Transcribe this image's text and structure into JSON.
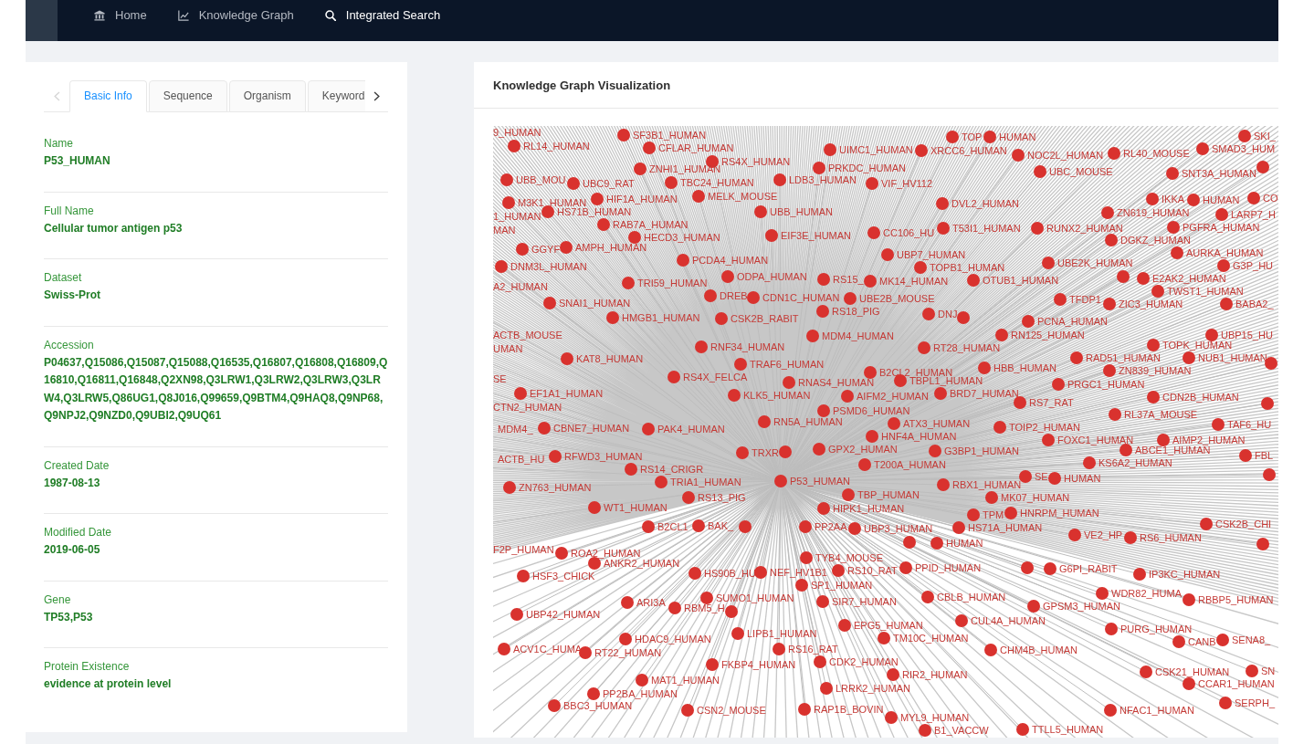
{
  "navbar": {
    "items": [
      {
        "label": "Home",
        "selected": false
      },
      {
        "label": "Knowledge Graph",
        "selected": false
      },
      {
        "label": "Integrated Search",
        "selected": true
      }
    ]
  },
  "detail_panel": {
    "scroll_buttons": [
      {
        "kind": "previous",
        "disabled": true
      },
      {
        "kind": "next",
        "disabled": false
      }
    ],
    "tabs": [
      {
        "label": "Basic Info",
        "selected": true
      },
      {
        "label": "Sequence",
        "selected": false
      },
      {
        "label": "Organism",
        "selected": false
      },
      {
        "label": "Keyword",
        "selected": false
      }
    ],
    "fields": [
      {
        "label": "Name",
        "value": "P53_HUMAN"
      },
      {
        "label": "Full Name",
        "value": "Cellular tumor antigen p53"
      },
      {
        "label": "Dataset",
        "value": "Swiss-Prot"
      },
      {
        "label": "Accession",
        "value": "P04637,Q15086,Q15087,Q15088,Q16535,Q16807,Q16808,Q16809,Q16810,Q16811,Q16848,Q2XN98,Q3LRW1,Q3LRW2,Q3LRW3,Q3LRW4,Q3LRW5,Q86UG1,Q8J016,Q99659,Q9BTM4,Q9HAQ8,Q9NP68,Q9NPJ2,Q9NZD0,Q9UBI2,Q9UQ61"
      },
      {
        "label": "Created Date",
        "value": "1987-08-13"
      },
      {
        "label": "Modified Date",
        "value": "2019-06-05"
      },
      {
        "label": "Gene",
        "value": "TP53,P53"
      },
      {
        "label": "Protein Existence",
        "value": "evidence at protein level"
      }
    ]
  },
  "graph_panel": {
    "title": "Knowledge Graph Visualization",
    "nodes": [
      {
        "kind": "labeled",
        "label": "9_HUMAN"
      },
      {
        "kind": "labeled",
        "label": "SF3B1_HUMAN"
      },
      {
        "kind": "labeled",
        "label": "TOP"
      },
      {
        "kind": "labeled",
        "label": "HUMAN"
      },
      {
        "kind": "labeled",
        "label": "SKI_"
      },
      {
        "kind": "labeled",
        "label": "RL14_HUMAN"
      },
      {
        "kind": "labeled",
        "label": "CFLAR_HUMAN"
      },
      {
        "kind": "labeled",
        "label": "UIMC1_HUMAN"
      },
      {
        "kind": "labeled",
        "label": "XRCC6_HUMAN"
      },
      {
        "kind": "labeled",
        "label": "NOC2L_HUMAN"
      },
      {
        "kind": "labeled",
        "label": "RL40_MOUSE"
      },
      {
        "kind": "labeled",
        "label": "SMAD3_HUM"
      },
      {
        "kind": "labeled",
        "label": "RS4X_HUMAN"
      },
      {
        "kind": "labeled",
        "label": "ZNHI1_HUMAN"
      },
      {
        "kind": "labeled",
        "label": "PRKDC_HUMAN"
      },
      {
        "kind": "labeled",
        "label": "UBC_MOUSE"
      },
      {
        "kind": "labeled",
        "label": "SNT3A_HUMAN"
      },
      {
        "kind": "unlabeled"
      },
      {
        "kind": "labeled",
        "label": "UBB_MOU"
      },
      {
        "kind": "labeled",
        "label": "UBC9_RAT"
      },
      {
        "kind": "labeled",
        "label": "TBC24_HUMAN"
      },
      {
        "kind": "labeled",
        "label": "LDB3_HUMAN"
      },
      {
        "kind": "labeled",
        "label": "VIF_HV112"
      },
      {
        "kind": "labeled",
        "label": "M3K1_HUMAN"
      },
      {
        "kind": "labeled",
        "label": "HIF1A_HUMAN"
      },
      {
        "kind": "labeled",
        "label": "MELK_MOUSE"
      },
      {
        "kind": "labeled",
        "label": "DVL2_HUMAN"
      },
      {
        "kind": "labeled",
        "label": "IKKA"
      },
      {
        "kind": "labeled",
        "label": "HUMAN"
      },
      {
        "kind": "labeled",
        "label": "CO"
      },
      {
        "kind": "labeled",
        "label": "1_HUMAN"
      },
      {
        "kind": "labeled",
        "label": "HS71B_HUMAN"
      },
      {
        "kind": "labeled",
        "label": "UBB_HUMAN"
      },
      {
        "kind": "labeled",
        "label": "ZN619_HUMAN"
      },
      {
        "kind": "labeled",
        "label": "LARP7_H"
      },
      {
        "kind": "labeled",
        "label": "MAN"
      },
      {
        "kind": "labeled",
        "label": "RAB7A_HUMAN"
      },
      {
        "kind": "labeled",
        "label": "HECD3_HUMAN"
      },
      {
        "kind": "labeled",
        "label": "EIF3E_HUMAN"
      },
      {
        "kind": "labeled",
        "label": "CC106_HU"
      },
      {
        "kind": "labeled",
        "label": "T53I1_HUMAN"
      },
      {
        "kind": "labeled",
        "label": "RUNX2_HUMAN"
      },
      {
        "kind": "labeled",
        "label": "PGFRA_HUMAN"
      },
      {
        "kind": "labeled",
        "label": "GGYF"
      },
      {
        "kind": "labeled",
        "label": "AMPH_HUMAN"
      },
      {
        "kind": "labeled",
        "label": "DGKZ_HUMAN"
      },
      {
        "kind": "labeled",
        "label": "PCDA4_HUMAN"
      },
      {
        "kind": "labeled",
        "label": "UBP7_HUMAN"
      },
      {
        "kind": "labeled",
        "label": "DNM3L_HUMAN"
      },
      {
        "kind": "labeled",
        "label": "TOPB1_HUMAN"
      },
      {
        "kind": "labeled",
        "label": "UBE2K_HUMAN"
      },
      {
        "kind": "labeled",
        "label": "AURKA_HUMAN"
      },
      {
        "kind": "labeled",
        "label": "G3P_HU"
      },
      {
        "kind": "labeled",
        "label": "ODPA_HUMAN"
      },
      {
        "kind": "labeled",
        "label": "A2_HUMAN"
      },
      {
        "kind": "labeled",
        "label": "TRI59_HUMAN"
      },
      {
        "kind": "labeled",
        "label": "RS15_"
      },
      {
        "kind": "labeled",
        "label": "MK14_HUMAN"
      },
      {
        "kind": "labeled",
        "label": "OTUB1_HUMAN"
      },
      {
        "kind": "unlabeled"
      },
      {
        "kind": "labeled",
        "label": "E2AK2_HUMAN"
      },
      {
        "kind": "labeled",
        "label": "DREB"
      },
      {
        "kind": "labeled",
        "label": "SNAI1_HUMAN"
      },
      {
        "kind": "labeled",
        "label": "CDN1C_HUMAN"
      },
      {
        "kind": "labeled",
        "label": "UBE2B_MOUSE"
      },
      {
        "kind": "labeled",
        "label": "TFDP1"
      },
      {
        "kind": "labeled",
        "label": "TWST1_HUMAN"
      },
      {
        "kind": "labeled",
        "label": "RS18_PIG"
      },
      {
        "kind": "labeled",
        "label": "HMGB1_HUMAN"
      },
      {
        "kind": "labeled",
        "label": "CSK2B_RABIT"
      },
      {
        "kind": "labeled",
        "label": "DNJ"
      },
      {
        "kind": "labeled",
        "label": "ZIC3_HUMAN"
      },
      {
        "kind": "labeled",
        "label": "BABA2_"
      },
      {
        "kind": "unlabeled"
      },
      {
        "kind": "labeled",
        "label": "PCNA_HUMAN"
      },
      {
        "kind": "labeled",
        "label": "ACTB_MOUSE"
      },
      {
        "kind": "labeled",
        "label": "MDM4_HUMAN"
      },
      {
        "kind": "labeled",
        "label": "RN125_HUMAN"
      },
      {
        "kind": "labeled",
        "label": "UBP15_HU"
      },
      {
        "kind": "labeled",
        "label": "UMAN"
      },
      {
        "kind": "labeled",
        "label": "RNF34_HUMAN"
      },
      {
        "kind": "labeled",
        "label": "RT28_HUMAN"
      },
      {
        "kind": "labeled",
        "label": "TOPK_HUMAN"
      },
      {
        "kind": "labeled",
        "label": "KAT8_HUMAN"
      },
      {
        "kind": "labeled",
        "label": "RAD51_HUMAN"
      },
      {
        "kind": "labeled",
        "label": "NUB1_HUMAN"
      },
      {
        "kind": "labeled",
        "label": "TRAF6_HUMAN"
      },
      {
        "kind": "labeled",
        "label": "SE"
      },
      {
        "kind": "labeled",
        "label": "RS4X_FELCA"
      },
      {
        "kind": "labeled",
        "label": "B2CL2_HUMAN"
      },
      {
        "kind": "labeled",
        "label": "HBB_HUMAN"
      },
      {
        "kind": "labeled",
        "label": "ZN839_HUMAN"
      },
      {
        "kind": "unlabeled"
      },
      {
        "kind": "labeled",
        "label": "RNAS4_HUMAN"
      },
      {
        "kind": "labeled",
        "label": "TBPL1_HUMAN"
      },
      {
        "kind": "labeled",
        "label": "PRGC1_HUMAN"
      },
      {
        "kind": "labeled",
        "label": "EF1A1_HUMAN"
      },
      {
        "kind": "labeled",
        "label": "KLK5_HUMAN"
      },
      {
        "kind": "labeled",
        "label": "AIFM2_HUMAN"
      },
      {
        "kind": "labeled",
        "label": "BRD7_HUMAN"
      },
      {
        "kind": "labeled",
        "label": "CTN2_HUMAN"
      },
      {
        "kind": "labeled",
        "label": "RS7_RAT"
      },
      {
        "kind": "labeled",
        "label": "CDN2B_HUMAN"
      },
      {
        "kind": "unlabeled"
      },
      {
        "kind": "labeled",
        "label": "PSMD6_HUMAN"
      },
      {
        "kind": "labeled",
        "label": "RL37A_MOUSE"
      },
      {
        "kind": "labeled",
        "label": "RN5A_HUMAN"
      },
      {
        "kind": "labeled",
        "label": "MDM4_"
      },
      {
        "kind": "labeled",
        "label": "CBNE7_HUMAN"
      },
      {
        "kind": "labeled",
        "label": "PAK4_HUMAN"
      },
      {
        "kind": "labeled",
        "label": "ATX3_HUMAN"
      },
      {
        "kind": "labeled",
        "label": "TOIP2_HUMAN"
      },
      {
        "kind": "labeled",
        "label": "TAF6_HU"
      },
      {
        "kind": "labeled",
        "label": "HNF4A_HUMAN"
      },
      {
        "kind": "labeled",
        "label": "FOXC1_HUMAN"
      },
      {
        "kind": "labeled",
        "label": "AIMP2_HUMAN"
      },
      {
        "kind": "labeled",
        "label": "ACTB_HU"
      },
      {
        "kind": "labeled",
        "label": "RFWD3_HUMAN"
      },
      {
        "kind": "labeled",
        "label": "TRXR"
      },
      {
        "kind": "unlabeled"
      },
      {
        "kind": "labeled",
        "label": "GPX2_HUMAN"
      },
      {
        "kind": "labeled",
        "label": "G3BP1_HUMAN"
      },
      {
        "kind": "labeled",
        "label": "ABCE1_HUMAN"
      },
      {
        "kind": "labeled",
        "label": "FBL"
      },
      {
        "kind": "labeled",
        "label": "RS14_CRIGR"
      },
      {
        "kind": "labeled",
        "label": "T200A_HUMAN"
      },
      {
        "kind": "labeled",
        "label": "KS6A2_HUMAN"
      },
      {
        "kind": "labeled",
        "label": "ZN763_HUMAN"
      },
      {
        "kind": "labeled",
        "label": "TRIA1_HUMAN"
      },
      {
        "kind": "labeled",
        "label": "P53_HUMAN"
      },
      {
        "kind": "labeled",
        "label": "SE"
      },
      {
        "kind": "labeled",
        "label": "HUMAN"
      },
      {
        "kind": "unlabeled"
      },
      {
        "kind": "labeled",
        "label": "RBX1_HUMAN"
      },
      {
        "kind": "labeled",
        "label": "RS13_PIG"
      },
      {
        "kind": "labeled",
        "label": "TBP_HUMAN"
      },
      {
        "kind": "labeled",
        "label": "MK07_HUMAN"
      },
      {
        "kind": "labeled",
        "label": "WT1_HUMAN"
      },
      {
        "kind": "labeled",
        "label": "HIPK1_HUMAN"
      },
      {
        "kind": "labeled",
        "label": "TPM"
      },
      {
        "kind": "labeled",
        "label": "HNRPM_HUMAN"
      },
      {
        "kind": "labeled",
        "label": "B2CL1"
      },
      {
        "kind": "labeled",
        "label": "BAK_"
      },
      {
        "kind": "unlabeled"
      },
      {
        "kind": "labeled",
        "label": "PP2AA"
      },
      {
        "kind": "labeled",
        "label": "UBP3_HUMAN"
      },
      {
        "kind": "labeled",
        "label": "HS71A_HUMAN"
      },
      {
        "kind": "labeled",
        "label": "CSK2B_CHI"
      },
      {
        "kind": "labeled",
        "label": "VE2_HP"
      },
      {
        "kind": "unlabeled"
      },
      {
        "kind": "labeled",
        "label": "HUMAN"
      },
      {
        "kind": "labeled",
        "label": "RS6_HUMAN"
      },
      {
        "kind": "unlabeled"
      },
      {
        "kind": "labeled",
        "label": "F2P_HUMAN"
      },
      {
        "kind": "labeled",
        "label": "ROA2_HUMAN"
      },
      {
        "kind": "labeled",
        "label": "ANKR2_HUMAN"
      },
      {
        "kind": "labeled",
        "label": "TYB4_MOUSE"
      },
      {
        "kind": "labeled",
        "label": "HSF3_CHICK"
      },
      {
        "kind": "labeled",
        "label": "HS90B_HU"
      },
      {
        "kind": "labeled",
        "label": "NEF_HV1B1"
      },
      {
        "kind": "labeled",
        "label": "RS10_RAT"
      },
      {
        "kind": "labeled",
        "label": "PPID_HUMAN"
      },
      {
        "kind": "unlabeled"
      },
      {
        "kind": "labeled",
        "label": "G6PI_RABIT"
      },
      {
        "kind": "labeled",
        "label": "IP3KC_HUMAN"
      },
      {
        "kind": "labeled",
        "label": "SP1_HUMAN"
      },
      {
        "kind": "labeled",
        "label": "ARI3A"
      },
      {
        "kind": "labeled",
        "label": "SUMO1_HUMAN"
      },
      {
        "kind": "labeled",
        "label": "SIR7_HUMAN"
      },
      {
        "kind": "labeled",
        "label": "CBLB_HUMAN"
      },
      {
        "kind": "labeled",
        "label": "WDR82_HUMA"
      },
      {
        "kind": "labeled",
        "label": "RBBP5_HUMAN"
      },
      {
        "kind": "labeled",
        "label": "RBM5_H"
      },
      {
        "kind": "labeled",
        "label": "GPSM3_HUMAN"
      },
      {
        "kind": "labeled",
        "label": "UBP42_HUMAN"
      },
      {
        "kind": "unlabeled"
      },
      {
        "kind": "labeled",
        "label": "EPG5_HUMAN"
      },
      {
        "kind": "labeled",
        "label": "CUL4A_HUMAN"
      },
      {
        "kind": "labeled",
        "label": "HDAC9_HUMAN"
      },
      {
        "kind": "labeled",
        "label": "LIPB1_HUMAN"
      },
      {
        "kind": "labeled",
        "label": "PURG_HUMAN"
      },
      {
        "kind": "labeled",
        "label": "TM10C_HUMAN"
      },
      {
        "kind": "labeled",
        "label": "CANB"
      },
      {
        "kind": "labeled",
        "label": "SENA8_"
      },
      {
        "kind": "labeled",
        "label": "ACV1C_HUMA"
      },
      {
        "kind": "labeled",
        "label": "RT22_HUMAN"
      },
      {
        "kind": "labeled",
        "label": "RS16_RAT"
      },
      {
        "kind": "labeled",
        "label": "CHM4B_HUMAN"
      },
      {
        "kind": "labeled",
        "label": "FKBP4_HUMAN"
      },
      {
        "kind": "labeled",
        "label": "CDK2_HUMAN"
      },
      {
        "kind": "labeled",
        "label": "MAT1_HUMAN"
      },
      {
        "kind": "labeled",
        "label": "RIR2_HUMAN"
      },
      {
        "kind": "labeled",
        "label": "CSK21_HUMAN"
      },
      {
        "kind": "labeled",
        "label": "SN"
      },
      {
        "kind": "labeled",
        "label": "PP2BA_HUMAN"
      },
      {
        "kind": "labeled",
        "label": "LRRK2_HUMAN"
      },
      {
        "kind": "labeled",
        "label": "CCAR1_HUMAN"
      },
      {
        "kind": "labeled",
        "label": "BBC3_HUMAN"
      },
      {
        "kind": "labeled",
        "label": "SERPH_"
      },
      {
        "kind": "labeled",
        "label": "CSN2_MOUSE"
      },
      {
        "kind": "labeled",
        "label": "RAP1B_BOVIN"
      },
      {
        "kind": "labeled",
        "label": "NFAC1_HUMAN"
      },
      {
        "kind": "labeled",
        "label": "MYL9_HUMAN"
      },
      {
        "kind": "labeled",
        "label": "B1_VACCW"
      },
      {
        "kind": "labeled",
        "label": "TTLL5_HUMAN"
      }
    ]
  }
}
